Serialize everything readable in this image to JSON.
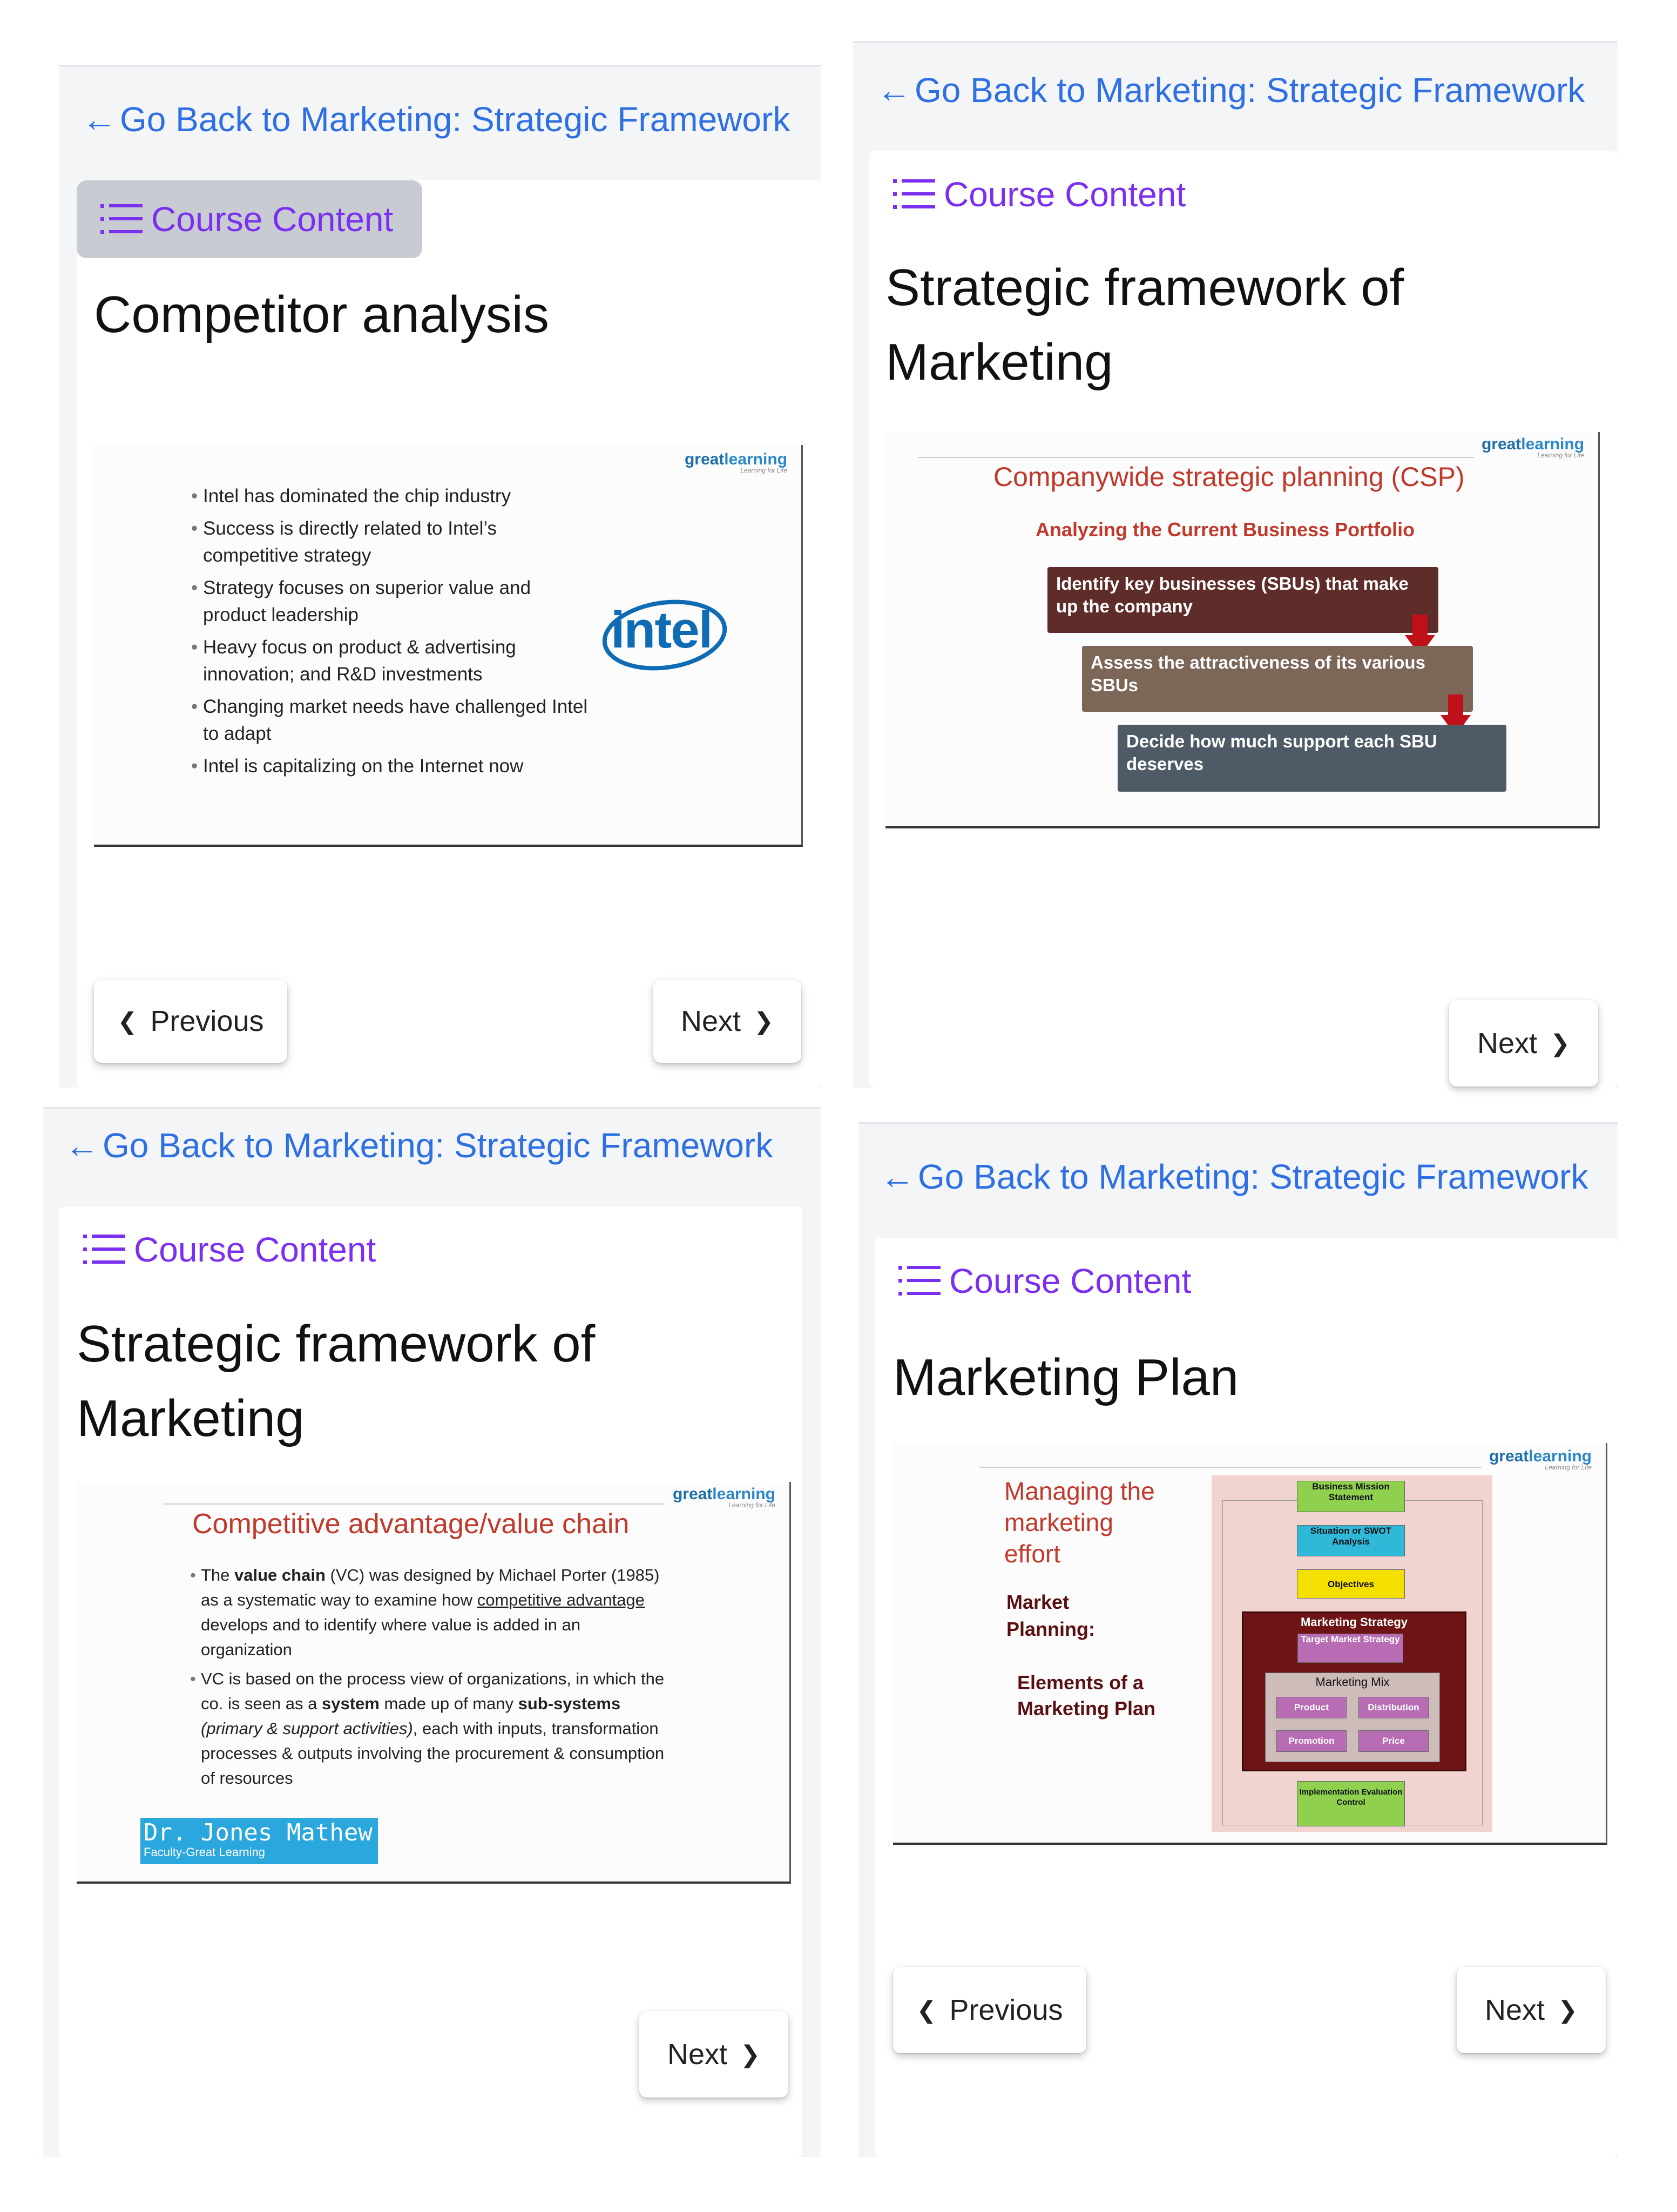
{
  "common": {
    "back_arrow": "←",
    "back_label": "Go Back to Marketing: Strategic Framework",
    "course_content_label": "Course Content",
    "previous_label": "Previous",
    "next_label": "Next",
    "chevron_left": "❮",
    "chevron_right": "❯",
    "logo_text_1": "great",
    "logo_text_2": "learning",
    "logo_tagline": "Learning for Life"
  },
  "screen1": {
    "title": "Competitor analysis",
    "bullets": [
      "Intel has dominated the chip industry",
      "Success is directly related to Intel’s competitive strategy",
      "Strategy focuses on superior value and product leadership",
      "Heavy focus on product & advertising innovation; and R&D investments",
      "Changing market needs have challenged Intel to adapt",
      "Intel is capitalizing on the Internet now"
    ],
    "intel_logo": "intel"
  },
  "screen2": {
    "title": "Strategic framework of Marketing",
    "slide_title": "Companywide strategic planning (CSP)",
    "slide_subtitle": "Analyzing the Current Business Portfolio",
    "steps": [
      "Identify key businesses (SBUs) that make up the company",
      "Assess the attractiveness of its various SBUs",
      "Decide how much support each SBU deserves"
    ]
  },
  "screen3": {
    "title": "Strategic framework of Marketing",
    "slide_title": "Competitive advantage/value chain",
    "presenter_name": "Dr. Jones Mathew",
    "presenter_role": "Faculty-Great Learning"
  },
  "screen4": {
    "title": "Marketing Plan",
    "slide_heading": "Managing the marketing effort",
    "label_market": "Market Planning:",
    "label_elements": "Elements of a Marketing Plan",
    "diagram": {
      "business_mission": "Business Mission Statement",
      "situation": "Situation or SWOT Analysis",
      "objectives": "Objectives",
      "marketing_strategy": "Marketing Strategy",
      "target_market": "Target Market Strategy",
      "marketing_mix": "Marketing Mix",
      "product": "Product",
      "distribution": "Distribution",
      "promotion": "Promotion",
      "price": "Price",
      "implementation": "Implementation Evaluation Control"
    }
  },
  "colors": {
    "link_blue": "#2f6fe4",
    "course_purple": "#7b2ff0",
    "slide_red": "#c0392b",
    "intel_blue": "#0f6bb3"
  }
}
